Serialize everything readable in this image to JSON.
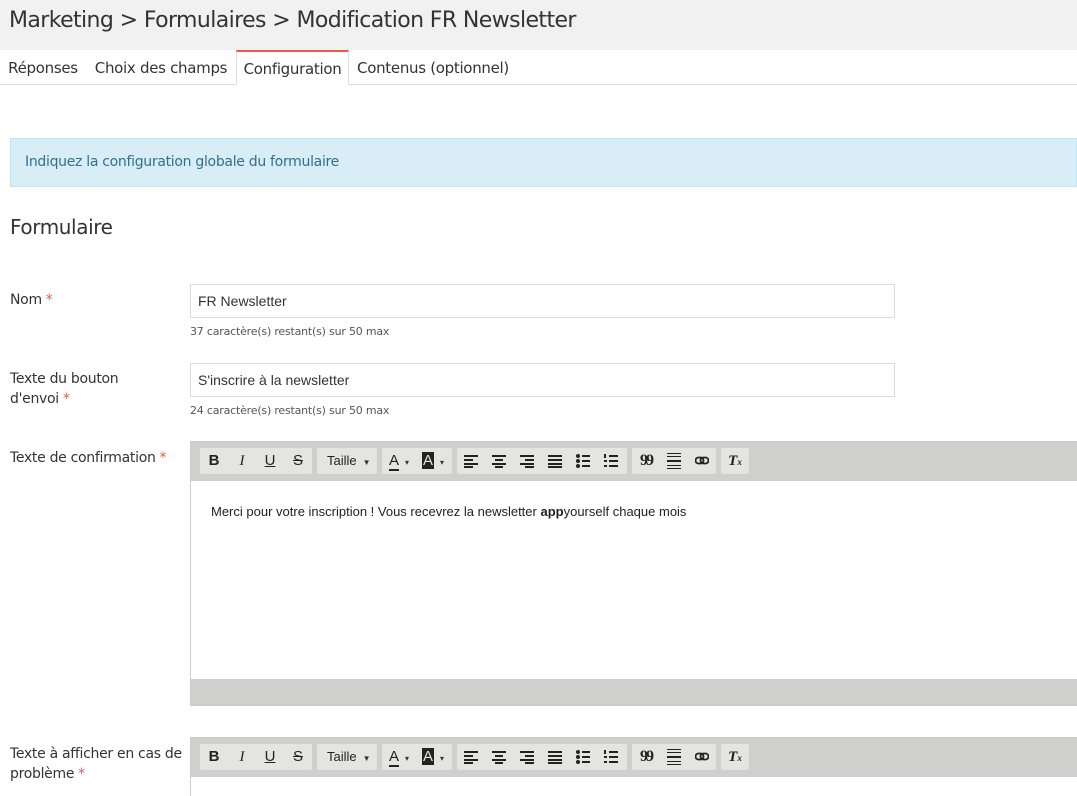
{
  "header": {
    "breadcrumb": "Marketing > Formulaires > Modification FR Newsletter"
  },
  "tabs": [
    {
      "label": "Réponses",
      "active": false
    },
    {
      "label": "Choix des champs",
      "active": false
    },
    {
      "label": "Configuration",
      "active": true
    },
    {
      "label": "Contenus (optionnel)",
      "active": false
    }
  ],
  "info": {
    "text": "Indiquez la configuration globale du formulaire"
  },
  "section": {
    "title": "Formulaire"
  },
  "fields": {
    "nom": {
      "label": "Nom",
      "required": "*",
      "value": "FR Newsletter",
      "hint": "37 caractère(s) restant(s) sur 50 max"
    },
    "bouton": {
      "label_line1": "Texte du bouton",
      "label_line2": "d'envoi",
      "required": "*",
      "value": "S'inscrire à la newsletter",
      "hint": "24 caractère(s) restant(s) sur 50 max"
    },
    "confirmation": {
      "label": "Texte de confirmation",
      "required": "*",
      "content_before": "Merci pour votre inscription ! Vous recevrez la newsletter ",
      "content_bold": "app",
      "content_after": "yourself chaque mois"
    },
    "probleme": {
      "label_line1": "Texte à afficher en cas de",
      "label_line2": "problème",
      "required": "*"
    }
  },
  "toolbar": {
    "bold": "B",
    "italic": "I",
    "underline": "U",
    "strike": "S",
    "size_label": "Taille",
    "text_color": "A",
    "bg_color": "A",
    "quote": "99",
    "clear_format": "T"
  },
  "colors": {
    "accent": "#e8594a",
    "info_bg": "#d9edf7",
    "info_text": "#31708f",
    "toolbar_bg": "#cfcfcd"
  }
}
